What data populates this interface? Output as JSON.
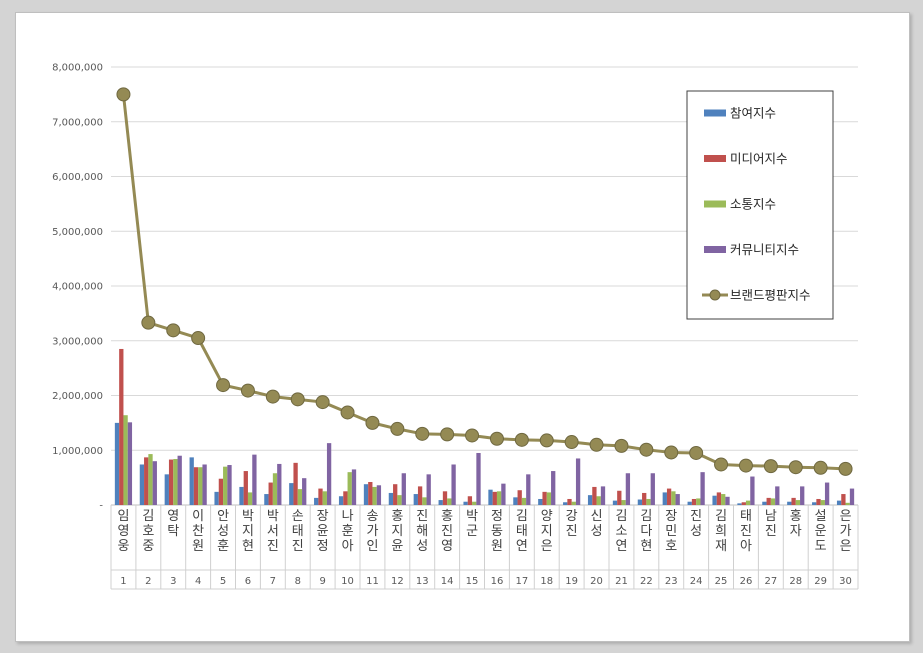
{
  "chart_data": {
    "type": "bar",
    "categories": [
      "임영웅",
      "김호중",
      "영탁",
      "이찬원",
      "안성훈",
      "박지현",
      "박서진",
      "손태진",
      "장윤정",
      "나훈아",
      "송가인",
      "홍지윤",
      "진해성",
      "홍진영",
      "박군",
      "정동원",
      "김태연",
      "양지은",
      "강진",
      "신성",
      "김소연",
      "김다현",
      "장민호",
      "진성",
      "김희재",
      "태진아",
      "남진",
      "홍자",
      "설운도",
      "은가은"
    ],
    "index_labels": [
      "1",
      "2",
      "3",
      "4",
      "5",
      "6",
      "7",
      "8",
      "9",
      "10",
      "11",
      "12",
      "13",
      "14",
      "15",
      "16",
      "17",
      "18",
      "19",
      "20",
      "21",
      "22",
      "23",
      "24",
      "25",
      "26",
      "27",
      "28",
      "29",
      "30"
    ],
    "series": [
      {
        "name": "참여지수",
        "color": "#4f81bd",
        "values": [
          1500000,
          740000,
          560000,
          870000,
          240000,
          330000,
          200000,
          400000,
          130000,
          160000,
          380000,
          220000,
          200000,
          90000,
          60000,
          280000,
          140000,
          110000,
          50000,
          180000,
          80000,
          100000,
          230000,
          60000,
          170000,
          30000,
          60000,
          60000,
          50000,
          80000
        ]
      },
      {
        "name": "미디어지수",
        "color": "#c0504d",
        "values": [
          2850000,
          870000,
          830000,
          690000,
          480000,
          620000,
          410000,
          770000,
          300000,
          250000,
          420000,
          380000,
          340000,
          250000,
          160000,
          240000,
          270000,
          240000,
          110000,
          330000,
          260000,
          220000,
          300000,
          110000,
          230000,
          50000,
          130000,
          130000,
          110000,
          200000
        ]
      },
      {
        "name": "소통지수",
        "color": "#9bbb59",
        "values": [
          1640000,
          930000,
          840000,
          690000,
          700000,
          230000,
          580000,
          290000,
          250000,
          600000,
          330000,
          180000,
          140000,
          120000,
          60000,
          250000,
          130000,
          230000,
          60000,
          160000,
          90000,
          110000,
          250000,
          120000,
          200000,
          80000,
          120000,
          90000,
          90000,
          40000
        ]
      },
      {
        "name": "커뮤니티지수",
        "color": "#8064a2",
        "values": [
          1510000,
          800000,
          900000,
          740000,
          730000,
          920000,
          750000,
          490000,
          1130000,
          650000,
          360000,
          580000,
          560000,
          740000,
          950000,
          390000,
          560000,
          620000,
          850000,
          340000,
          580000,
          580000,
          200000,
          600000,
          150000,
          520000,
          340000,
          340000,
          410000,
          300000
        ]
      },
      {
        "name": "브랜드평판지수",
        "type": "line",
        "color": "#948a54",
        "values": [
          7500000,
          3330000,
          3190000,
          3050000,
          2190000,
          2090000,
          1980000,
          1930000,
          1880000,
          1690000,
          1500000,
          1390000,
          1300000,
          1290000,
          1270000,
          1210000,
          1190000,
          1180000,
          1150000,
          1100000,
          1080000,
          1010000,
          960000,
          950000,
          740000,
          720000,
          710000,
          690000,
          680000,
          660000
        ]
      }
    ],
    "y_ticks": [
      "-",
      "1,000,000",
      "2,000,000",
      "3,000,000",
      "4,000,000",
      "5,000,000",
      "6,000,000",
      "7,000,000",
      "8,000,000"
    ],
    "ylim": [
      0,
      8000000
    ],
    "grid": true,
    "legend_position": "right"
  }
}
